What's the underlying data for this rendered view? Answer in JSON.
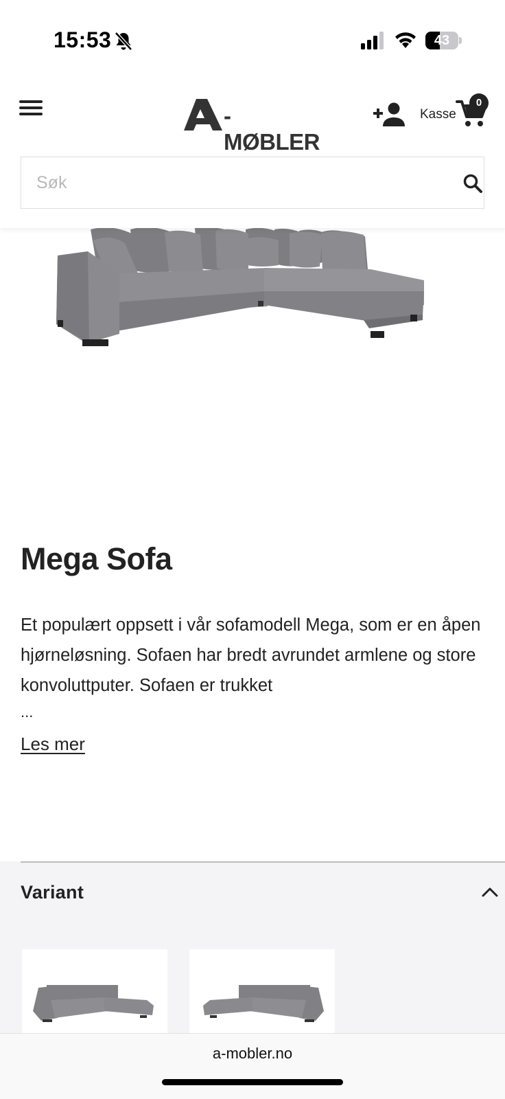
{
  "status_bar": {
    "time": "15:53",
    "battery": "43",
    "battery_level": 0.43
  },
  "header": {
    "logo_text": "-MØBLER",
    "checkout_label": "Kasse",
    "cart_count": "0"
  },
  "search": {
    "placeholder": "Søk",
    "value": ""
  },
  "product": {
    "title": "Mega Sofa",
    "description": "Et populært oppsett i vår sofamodell Mega, som er en åpen hjørneløsning. Sofaen har bredt avrundet armlene og store konvoluttputer. Sofaen er trukket",
    "ellipsis": "...",
    "read_more": "Les mer"
  },
  "variant": {
    "title": "Variant"
  },
  "browser": {
    "url": "a-mobler.no"
  },
  "colors": {
    "text": "#222222",
    "sofa": "#8a8a8d",
    "variant_bg": "#f4f3f6"
  },
  "icons": [
    "bell-slash-icon",
    "signal-icon",
    "wifi-icon",
    "battery-icon",
    "hamburger-menu-icon",
    "add-user-icon",
    "cart-icon",
    "search-icon",
    "chevron-up-icon"
  ]
}
